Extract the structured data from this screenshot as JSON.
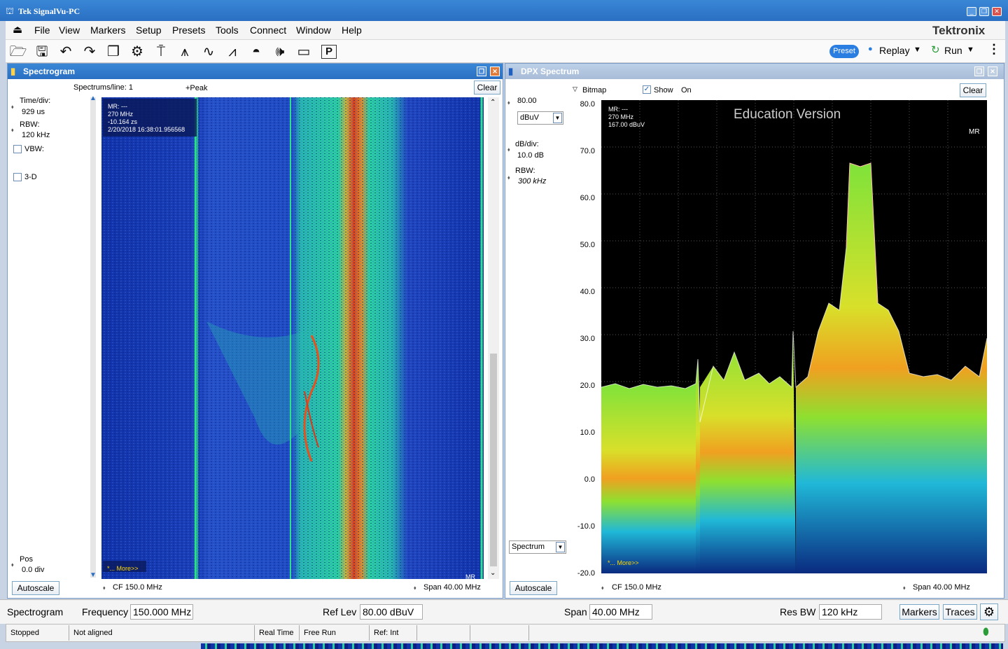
{
  "window": {
    "title": "Tek SignalVu-PC",
    "brand": "Tektronix"
  },
  "menu": [
    "File",
    "View",
    "Markers",
    "Setup",
    "Presets",
    "Tools",
    "Connect",
    "Window",
    "Help"
  ],
  "toolbar": {
    "preset_label": "Preset",
    "replay_label": "Replay",
    "run_label": "Run",
    "icons": [
      "open-icon",
      "save-icon",
      "undo-icon",
      "redo-icon",
      "windows-icon",
      "settings-icon",
      "trigger-icon",
      "spectrum-icon",
      "dpx-icon",
      "demod-icon",
      "satellite-icon",
      "audio-icon",
      "record-icon",
      "pulse-icon"
    ]
  },
  "spectrogram": {
    "title": "Spectrogram",
    "spectrums_per_line": "Spectrums/line: 1",
    "detector": "+Peak",
    "clear_label": "Clear",
    "time_div_label": "Time/div:",
    "time_div_value": "929 us",
    "rbw_label": "RBW:",
    "rbw_value": "120 kHz",
    "vbw_label": "VBW:",
    "threed_label": "3-D",
    "pos_label": "Pos",
    "pos_value": "0.0 div",
    "autoscale_label": "Autoscale",
    "cf": "CF  150.0 MHz",
    "span": "Span  40.00 MHz",
    "marker": {
      "l1": "MR: ---",
      "l2": "270 MHz",
      "l3": "-10.164 zs",
      "l4": "2/20/2018 16:38:01.956568"
    },
    "more": "*... More>>",
    "mr": "MR"
  },
  "dpx": {
    "title": "DPX Spectrum",
    "bitmap_label": "Bitmap",
    "show_label": "Show",
    "on_label": "On",
    "clear_label": "Clear",
    "ref_value": "80.00",
    "unit": "dBuV",
    "db_div_label": "dB/div:",
    "db_div_value": "10.0 dB",
    "rbw_label": "RBW:",
    "rbw_value": "300 kHz",
    "trace_select": "Spectrum",
    "autoscale_label": "Autoscale",
    "cf": "CF  150.0 MHz",
    "span": "Span  40.00 MHz",
    "marker": {
      "l1": "MR: ---",
      "l2": "270 MHz",
      "l3": "167.00 dBuV"
    },
    "watermark": "Education Version",
    "more": "*... More>>",
    "mr": "MR",
    "yticks": [
      "80.0",
      "70.0",
      "60.0",
      "50.0",
      "40.0",
      "30.0",
      "20.0",
      "10.0",
      "0.0",
      "-10.0",
      "-20.0"
    ]
  },
  "bottom": {
    "mode": "Spectrogram",
    "freq_label": "Frequency",
    "freq_value": "150.000 MHz",
    "reflev_label": "Ref Lev",
    "reflev_value": "80.00 dBuV",
    "span_label": "Span",
    "span_value": "40.00 MHz",
    "resbw_label": "Res BW",
    "resbw_value": "120 kHz",
    "markers_label": "Markers",
    "traces_label": "Traces"
  },
  "status": {
    "s1": "Stopped",
    "s2": "Not aligned",
    "s3": "Real Time",
    "s4": "Free Run",
    "s5": "Ref: Int"
  },
  "colors": {
    "title_bar": "#2a6fc2",
    "panel_head_active": "#2a6fc2",
    "panel_head_inactive": "#a8bcd8",
    "spectro_bg": "#1530a8",
    "dpx_bg": "#000000",
    "preset_badge": "#2a7de1"
  }
}
